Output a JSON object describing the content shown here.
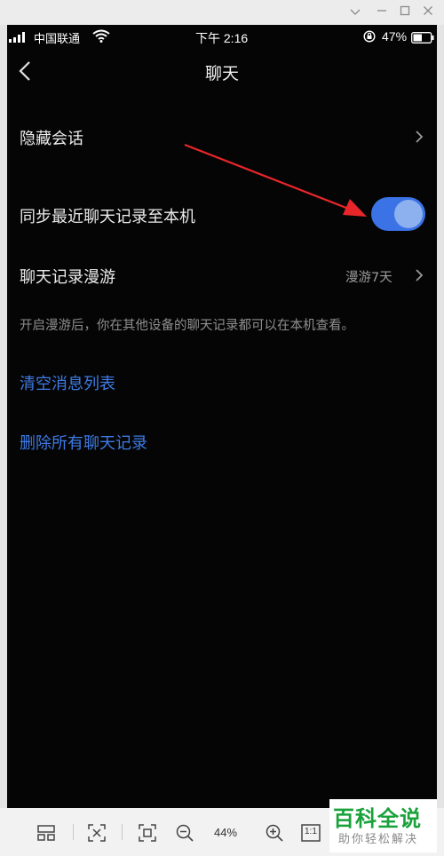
{
  "status_bar": {
    "carrier": "中国联通",
    "time": "下午 2:16",
    "battery_percent": "47%"
  },
  "nav": {
    "title": "聊天"
  },
  "settings": {
    "hide_conversations": "隐藏会话",
    "sync_recent": "同步最近聊天记录至本机",
    "sync_enabled": true,
    "roaming_label": "聊天记录漫游",
    "roaming_value": "漫游7天",
    "roaming_hint": "开启漫游后，你在其他设备的聊天记录都可以在本机查看。",
    "clear_list": "清空消息列表",
    "delete_all": "删除所有聊天记录"
  },
  "viewer_toolbar": {
    "zoom_level": "44%",
    "actual_size": "1:1"
  },
  "watermark": {
    "title": "百科全说",
    "subtitle": "助你轻松解决"
  },
  "colors": {
    "accent_blue": "#3e7be6",
    "toggle_on": "#3b73e6",
    "annotation_arrow": "#e8262a",
    "watermark_green": "#19a23a"
  }
}
